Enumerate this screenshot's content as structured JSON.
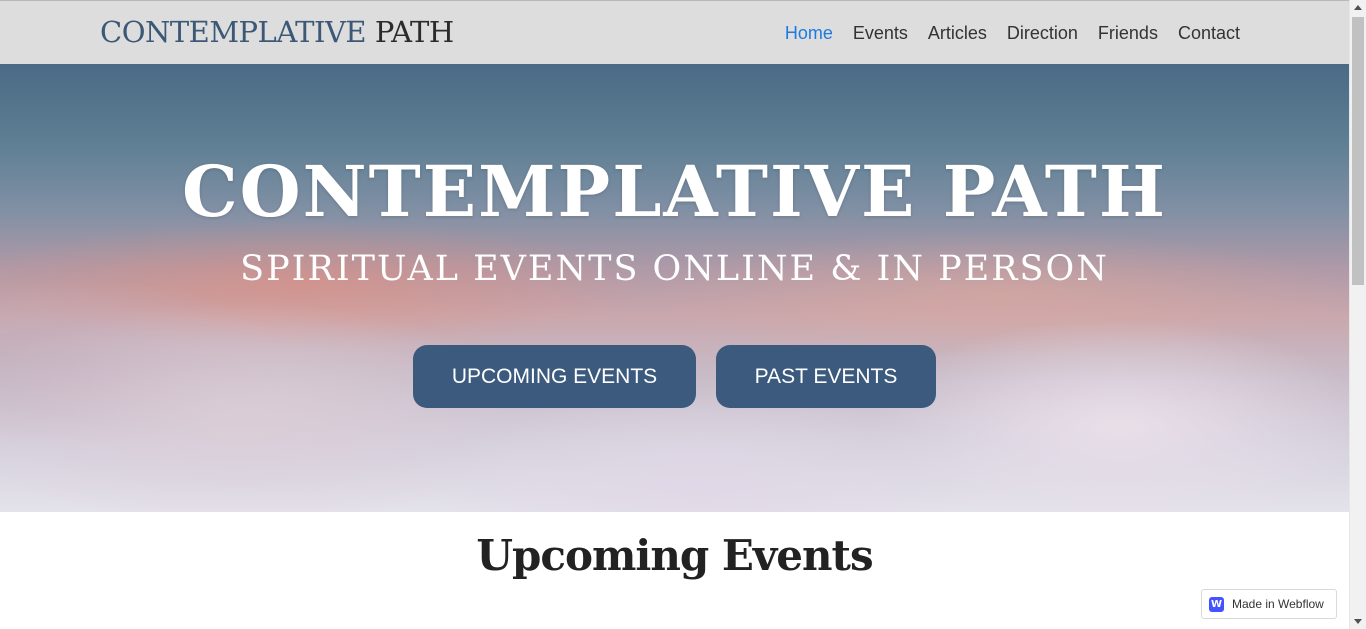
{
  "nav": {
    "brand_part1": "CONTEMPLATIVE",
    "brand_part2": "PATH",
    "links": [
      "Home",
      "Events",
      "Articles",
      "Direction",
      "Friends",
      "Contact"
    ],
    "active": "Home"
  },
  "hero": {
    "title": "CONTEMPLATIVE PATH",
    "subtitle": "SPIRITUAL EVENTS ONLINE & IN PERSON",
    "buttons": {
      "upcoming": "UPCOMING EVENTS",
      "past": "PAST EVENTS"
    }
  },
  "section": {
    "heading": "Upcoming Events"
  },
  "badge": {
    "text": "Made in Webflow",
    "logo_letter": "W",
    "icon": "webflow-logo-icon"
  },
  "colors": {
    "accent_link": "#1f7ae0",
    "button_bg": "#3b5a7d",
    "nav_bg": "#dddddd",
    "brand_blue": "#3b5877"
  }
}
